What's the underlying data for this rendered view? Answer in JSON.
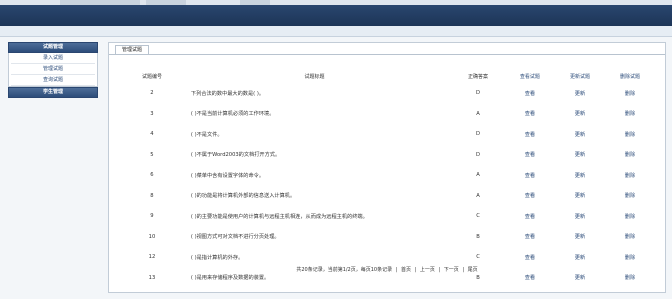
{
  "sidebar": {
    "section1": "试题管理",
    "items": [
      "录入试题",
      "管理试题",
      "查询试题"
    ],
    "section2": "学生管理"
  },
  "tab": "管理试题",
  "table": {
    "headers": [
      "试题编号",
      "试题标题",
      "正确答案",
      "查看试题",
      "更新试题",
      "删除试题"
    ],
    "rows": [
      {
        "id": "2",
        "title": "下列合法的数中最大的数是( )。",
        "answer": "D",
        "view": "查看",
        "edit": "更新",
        "del": "删除"
      },
      {
        "id": "3",
        "title": "( )不是当前计算机必须的工作环境。",
        "answer": "A",
        "view": "查看",
        "edit": "更新",
        "del": "删除"
      },
      {
        "id": "4",
        "title": "( )不是文件。",
        "answer": "D",
        "view": "查看",
        "edit": "更新",
        "del": "删除"
      },
      {
        "id": "5",
        "title": "( )不属于Word2003的文档打开方式。",
        "answer": "D",
        "view": "查看",
        "edit": "更新",
        "del": "删除"
      },
      {
        "id": "6",
        "title": "( )菜单中含有设置字体的命令。",
        "answer": "A",
        "view": "查看",
        "edit": "更新",
        "del": "删除"
      },
      {
        "id": "8",
        "title": "( )的功能是将计算机外部的信息送入计算机。",
        "answer": "A",
        "view": "查看",
        "edit": "更新",
        "del": "删除"
      },
      {
        "id": "9",
        "title": "( )的主要功能是使用户的计算机与远程主机相连，从而成为远程主机的终端。",
        "answer": "C",
        "view": "查看",
        "edit": "更新",
        "del": "删除"
      },
      {
        "id": "10",
        "title": "( )视图方式可对文档不进行分页处理。",
        "answer": "B",
        "view": "查看",
        "edit": "更新",
        "del": "删除"
      },
      {
        "id": "12",
        "title": "( )是指计算机的外存。",
        "answer": "C",
        "view": "查看",
        "edit": "更新",
        "del": "删除"
      },
      {
        "id": "13",
        "title": "( )是用来存储程序及数据的装置。",
        "answer": "B",
        "view": "查看",
        "edit": "更新",
        "del": "删除"
      }
    ]
  },
  "pager": {
    "summary": "共20条记录，当前第1/2页，每页10条记录",
    "first": "首页",
    "prev": "上一页",
    "next": "下一页",
    "last": "尾页"
  }
}
